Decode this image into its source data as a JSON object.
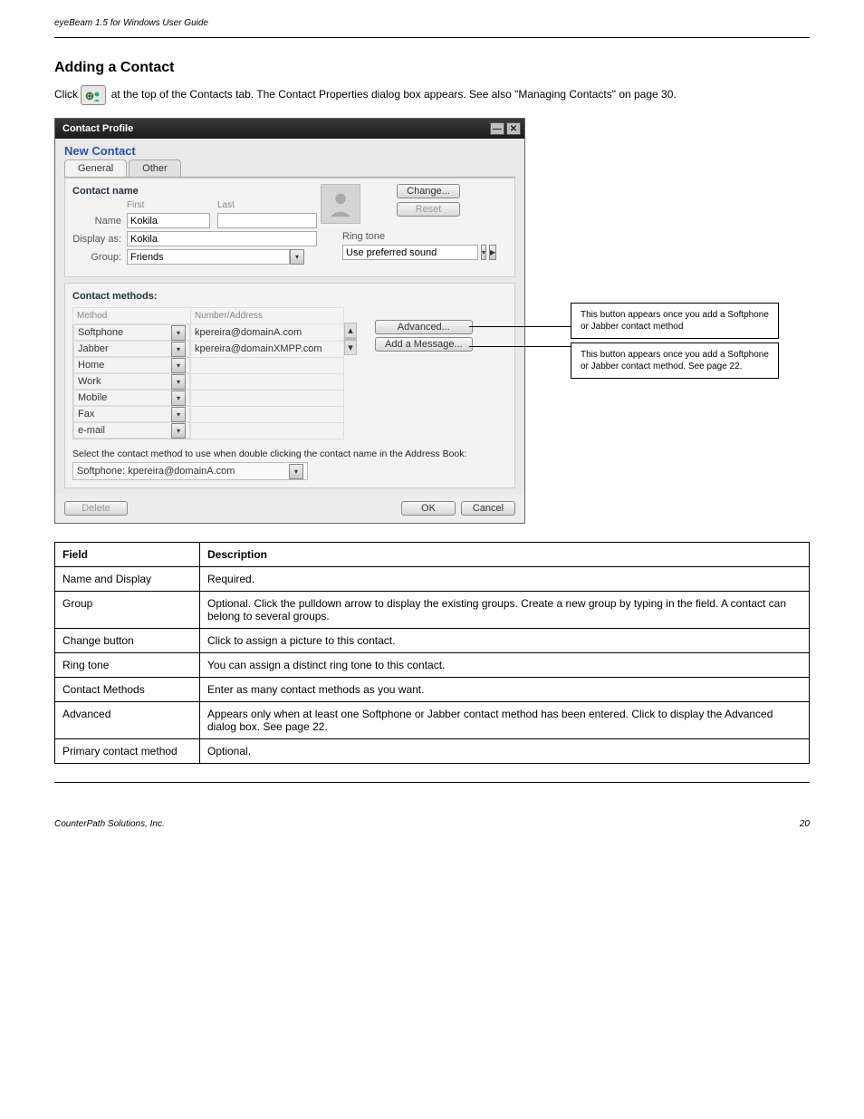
{
  "header": {
    "left": "eyeBeam 1.5 for Windows User Guide",
    "right": ""
  },
  "section": {
    "title": "Adding a Contact",
    "intro_p1_a": "Click ",
    "intro_p1_b": " at the top of the Contacts tab. The Contact Properties dialog box appears. See also \"Managing Contacts\" on page 30."
  },
  "window": {
    "title": "Contact Profile",
    "subheader": "New Contact",
    "tabs": {
      "general": "General",
      "other": "Other"
    },
    "contact_name_label": "Contact name",
    "first_label": "First",
    "last_label": "Last",
    "name_label": "Name",
    "name_value": "Kokila",
    "display_as_label": "Display as:",
    "display_as_value": "Kokila",
    "group_label": "Group:",
    "group_value": "Friends",
    "change_btn": "Change...",
    "reset_btn": "Reset",
    "ringtone_label": "Ring tone",
    "ringtone_value": "Use preferred sound",
    "contact_methods_label": "Contact methods:",
    "col_method": "Method",
    "col_addr": "Number/Address",
    "methods": [
      {
        "name": "Softphone",
        "addr": "kpereira@domainA.com"
      },
      {
        "name": "Jabber",
        "addr": "kpereira@domainXMPP.com"
      },
      {
        "name": "Home",
        "addr": ""
      },
      {
        "name": "Work",
        "addr": ""
      },
      {
        "name": "Mobile",
        "addr": ""
      },
      {
        "name": "Fax",
        "addr": ""
      },
      {
        "name": "e-mail",
        "addr": ""
      }
    ],
    "advanced_btn": "Advanced...",
    "add_message_btn": "Add a Message...",
    "select_hint": "Select the contact method to use when double clicking the contact name in the Address Book:",
    "primary_method": "Softphone: kpereira@domainA.com",
    "delete_btn": "Delete",
    "ok_btn": "OK",
    "cancel_btn": "Cancel",
    "callout1": "This button appears once you add a Softphone or Jabber contact method",
    "callout2": "This button appears once you add a Softphone or Jabber contact method. See page 22."
  },
  "desc_table": {
    "h_field": "Field",
    "h_desc": "Description",
    "rows": [
      {
        "f": "Name and Display",
        "d": "Required."
      },
      {
        "f": "Group",
        "d": "Optional. Click the pulldown arrow to display the existing groups. Create a new group by typing in the field. A contact can belong to several groups."
      },
      {
        "f": "Change button",
        "d": "Click to assign a picture to this contact."
      },
      {
        "f": "Ring tone",
        "d": "You can assign a distinct ring tone to this contact."
      },
      {
        "f": "Contact Methods",
        "d": "Enter as many contact methods as you want."
      },
      {
        "f": "Advanced",
        "d": "Appears only when at least one Softphone or Jabber contact method has been entered. Click to display the Advanced dialog box. See page 22."
      },
      {
        "f": "Primary contact method",
        "d": "Optional."
      }
    ]
  },
  "footer": {
    "left": "CounterPath Solutions, Inc.",
    "right": "20"
  }
}
